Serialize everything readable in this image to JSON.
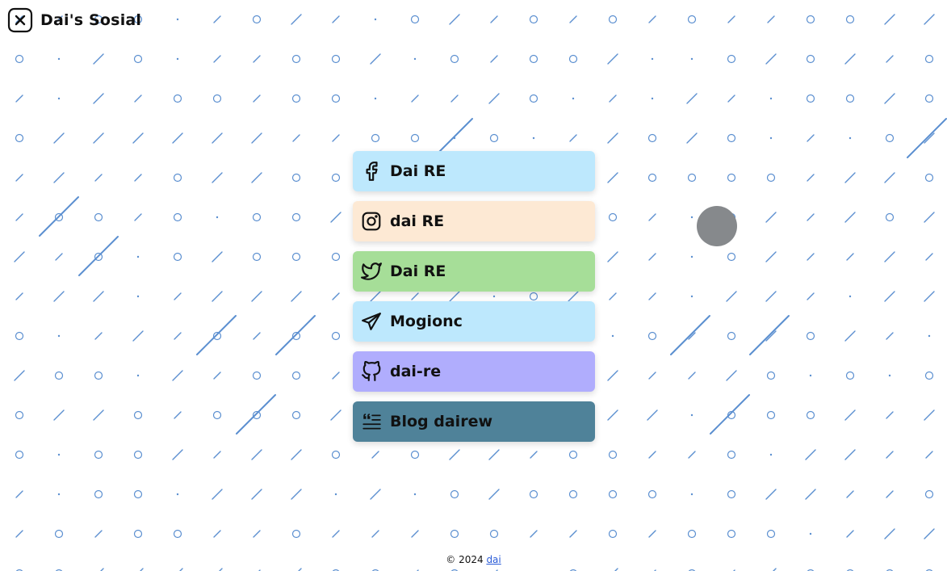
{
  "header": {
    "title": "Dai's Sosial",
    "logo_icon": "close-x-icon"
  },
  "colors": {
    "pattern": "#5b8fd0",
    "cursor_dot": "#86898c"
  },
  "links": [
    {
      "label": "Dai RE",
      "icon": "facebook-icon",
      "color": "#bde8fd"
    },
    {
      "label": "dai RE",
      "icon": "instagram-icon",
      "color": "#fde9d4"
    },
    {
      "label": "Dai RE",
      "icon": "twitter-icon",
      "color": "#a6de98"
    },
    {
      "label": "Mogionc",
      "icon": "telegram-icon",
      "color": "#bde8fd"
    },
    {
      "label": "dai-re",
      "icon": "github-icon",
      "color": "#b0adfd"
    },
    {
      "label": "Blog dairew",
      "icon": "blog-quote-icon",
      "color": "#4f8299"
    }
  ],
  "footer": {
    "copyright": "© 2024",
    "author_link": "dai"
  }
}
